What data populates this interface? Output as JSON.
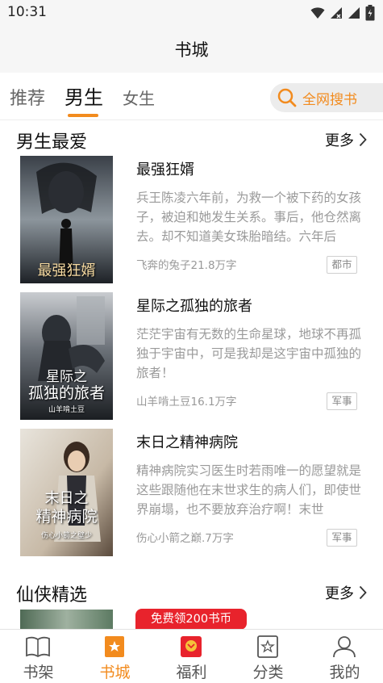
{
  "status_bar": {
    "time": "10:31"
  },
  "header": {
    "title": "书城"
  },
  "tabs": [
    {
      "label": "推荐",
      "active": false
    },
    {
      "label": "男生",
      "active": true
    },
    {
      "label": "女生",
      "active": false
    }
  ],
  "search": {
    "label": "全网搜书"
  },
  "sections": [
    {
      "title": "男生最爱",
      "more_label": "更多",
      "books": [
        {
          "title": "最强狂婿",
          "description": "兵王陈凌六年前，为救一个被下药的女孩子，被迫和她发生关系。事后，他仓然离去。却不知道美女珠胎暗结。六年后",
          "author_words": "飞奔的兔子21.8万字",
          "tag": "都市",
          "cover_text": "最强狂婿"
        },
        {
          "title": "星际之孤独的旅者",
          "description": "茫茫宇宙有无数的生命星球，地球不再孤独于宇宙中，可是我却是这宇宙中孤独的旅者！",
          "author_words": "山羊啃土豆16.1万字",
          "tag": "军事",
          "cover_text_1": "星际之",
          "cover_text_2": "孤独的旅者",
          "cover_author": "山羊啃土豆"
        },
        {
          "title": "末日之精神病院",
          "description": "精神病院实习医生时若雨唯一的愿望就是这些跟随他在末世求生的病人们，即使世界崩塌，也不要放弃治疗啊！末世",
          "author_words": "伤心小箭之巅.7万字",
          "tag": "军事",
          "cover_text_1": "末日之",
          "cover_text_2": "精神病院",
          "cover_author": "伤心小箭之壁少"
        }
      ]
    },
    {
      "title": "仙侠精选",
      "more_label": "更多"
    }
  ],
  "promo": {
    "label": "免费领200书币"
  },
  "bottom_nav": [
    {
      "label": "书架",
      "icon": "book-open-icon",
      "active": false
    },
    {
      "label": "书城",
      "icon": "bookmark-star-icon",
      "active": true
    },
    {
      "label": "福利",
      "icon": "gift-icon",
      "active": false
    },
    {
      "label": "分类",
      "icon": "category-star-icon",
      "active": false
    },
    {
      "label": "我的",
      "icon": "profile-icon",
      "active": false
    }
  ],
  "colors": {
    "accent": "#f28b1e",
    "promo": "#e8232c",
    "muted_text": "#9a9a9a"
  }
}
